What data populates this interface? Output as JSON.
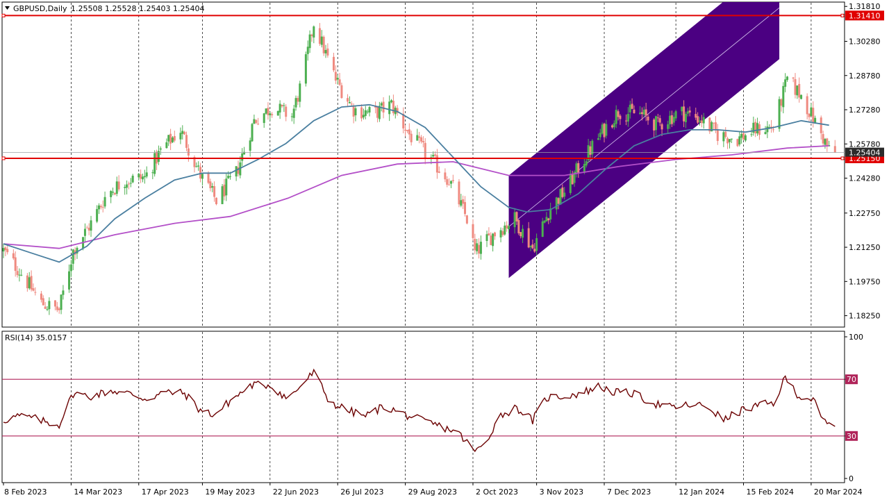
{
  "header": {
    "symbol": "GBPUSD,Daily",
    "ohlc": "1.25508 1.25528 1.25403 1.25404"
  },
  "rsi_header": {
    "label": "RSI(14) 35.0157"
  },
  "colors": {
    "background": "#ffffff",
    "up_candle": "#4caf50",
    "down_candle": "#ef8a80",
    "sma50": "#4a7fa0",
    "sma200": "#b34fc8",
    "channel_fill": "#4b0082",
    "hline": "#e00000",
    "rsi_line": "#6b0000",
    "rsi_level": "#b0245a",
    "grid": "#000000",
    "price_tag_bg": "#2b2b2b"
  },
  "icons": {
    "symbol_menu": "triangle-down-icon"
  },
  "chart_data": [
    {
      "type": "candlestick",
      "title": "GBPUSD,Daily",
      "ylim": [
        1.1775,
        1.32
      ],
      "y_ticks": [
        "1.31810",
        "1.30280",
        "1.28780",
        "1.27280",
        "1.25780",
        "1.24280",
        "1.22750",
        "1.21250",
        "1.19750",
        "1.18250"
      ],
      "x_ticks": [
        "8 Feb 2023",
        "14 Mar 2023",
        "17 Apr 2023",
        "19 May 2023",
        "22 Jun 2023",
        "26 Jul 2023",
        "29 Aug 2023",
        "2 Oct 2023",
        "3 Nov 2023",
        "7 Dec 2023",
        "12 Jan 2024",
        "15 Feb 2024",
        "20 Mar 2024"
      ],
      "x_range_days": [
        0,
        420
      ],
      "current_price": "1.25404",
      "horizontal_levels": [
        {
          "value": 1.3141,
          "label": "1.31410"
        },
        {
          "value": 1.2515,
          "label": "1.25150"
        }
      ],
      "channel": {
        "upper": [
          {
            "date": "20 Oct 2023",
            "value": 1.244
          },
          {
            "date": "4 Mar 2024",
            "value": 1.34
          }
        ],
        "lower": [
          {
            "date": "20 Oct 2023",
            "value": 1.199
          },
          {
            "date": "4 Mar 2024",
            "value": 1.295
          }
        ],
        "center": [
          {
            "date": "20 Oct 2023",
            "value": 1.2215
          },
          {
            "date": "4 Mar 2024",
            "value": 1.3175
          }
        ]
      },
      "price_path": [
        [
          "2023-02-08",
          1.211
        ],
        [
          "2023-02-17",
          1.201
        ],
        [
          "2023-02-27",
          1.188
        ],
        [
          "2023-03-08",
          1.185
        ],
        [
          "2023-03-15",
          1.211
        ],
        [
          "2023-03-24",
          1.223
        ],
        [
          "2023-04-01",
          1.236
        ],
        [
          "2023-04-10",
          1.242
        ],
        [
          "2023-04-20",
          1.243
        ],
        [
          "2023-04-29",
          1.256
        ],
        [
          "2023-05-08",
          1.264
        ],
        [
          "2023-05-18",
          1.244
        ],
        [
          "2023-05-26",
          1.233
        ],
        [
          "2023-06-05",
          1.245
        ],
        [
          "2023-06-14",
          1.268
        ],
        [
          "2023-06-23",
          1.274
        ],
        [
          "2023-07-03",
          1.27
        ],
        [
          "2023-07-08",
          1.285
        ],
        [
          "2023-07-14",
          1.311
        ],
        [
          "2023-07-25",
          1.286
        ],
        [
          "2023-08-03",
          1.273
        ],
        [
          "2023-08-13",
          1.271
        ],
        [
          "2023-08-22",
          1.275
        ],
        [
          "2023-08-31",
          1.262
        ],
        [
          "2023-09-10",
          1.252
        ],
        [
          "2023-09-20",
          1.242
        ],
        [
          "2023-09-30",
          1.223
        ],
        [
          "2023-10-03",
          1.21
        ],
        [
          "2023-10-13",
          1.219
        ],
        [
          "2023-10-23",
          1.225
        ],
        [
          "2023-11-01",
          1.212
        ],
        [
          "2023-11-10",
          1.23
        ],
        [
          "2023-11-17",
          1.237
        ],
        [
          "2023-11-26",
          1.25
        ],
        [
          "2023-12-05",
          1.262
        ],
        [
          "2023-12-14",
          1.272
        ],
        [
          "2023-12-25",
          1.271
        ],
        [
          "2024-01-03",
          1.266
        ],
        [
          "2024-01-14",
          1.272
        ],
        [
          "2024-01-24",
          1.269
        ],
        [
          "2024-02-02",
          1.262
        ],
        [
          "2024-02-12",
          1.26
        ],
        [
          "2024-02-21",
          1.264
        ],
        [
          "2024-03-01",
          1.265
        ],
        [
          "2024-03-08",
          1.286
        ],
        [
          "2024-03-15",
          1.279
        ],
        [
          "2024-03-24",
          1.264
        ],
        [
          "2024-03-29",
          1.255
        ],
        [
          "2024-04-01",
          1.254
        ]
      ],
      "sma50": [
        [
          "2023-02-08",
          1.214
        ],
        [
          "2023-02-22",
          1.21
        ],
        [
          "2023-03-08",
          1.206
        ],
        [
          "2023-03-22",
          1.213
        ],
        [
          "2023-04-05",
          1.225
        ],
        [
          "2023-04-20",
          1.234
        ],
        [
          "2023-05-05",
          1.242
        ],
        [
          "2023-05-19",
          1.245
        ],
        [
          "2023-06-02",
          1.245
        ],
        [
          "2023-06-16",
          1.251
        ],
        [
          "2023-06-30",
          1.258
        ],
        [
          "2023-07-14",
          1.268
        ],
        [
          "2023-07-28",
          1.274
        ],
        [
          "2023-08-11",
          1.275
        ],
        [
          "2023-08-25",
          1.272
        ],
        [
          "2023-09-08",
          1.265
        ],
        [
          "2023-09-22",
          1.252
        ],
        [
          "2023-10-06",
          1.239
        ],
        [
          "2023-10-20",
          1.23
        ],
        [
          "2023-10-29",
          1.228
        ],
        [
          "2023-11-10",
          1.229
        ],
        [
          "2023-11-24",
          1.236
        ],
        [
          "2023-12-08",
          1.247
        ],
        [
          "2023-12-22",
          1.257
        ],
        [
          "2024-01-05",
          1.262
        ],
        [
          "2024-01-19",
          1.264
        ],
        [
          "2024-02-02",
          1.264
        ],
        [
          "2024-02-16",
          1.263
        ],
        [
          "2024-03-01",
          1.265
        ],
        [
          "2024-03-15",
          1.268
        ],
        [
          "2024-03-29",
          1.266
        ]
      ],
      "sma200": [
        [
          "2023-02-08",
          1.214
        ],
        [
          "2023-03-08",
          1.212
        ],
        [
          "2023-04-05",
          1.218
        ],
        [
          "2023-05-05",
          1.223
        ],
        [
          "2023-06-02",
          1.226
        ],
        [
          "2023-07-01",
          1.234
        ],
        [
          "2023-07-28",
          1.244
        ],
        [
          "2023-08-25",
          1.249
        ],
        [
          "2023-09-22",
          1.25
        ],
        [
          "2023-10-20",
          1.244
        ],
        [
          "2023-11-17",
          1.244
        ],
        [
          "2023-12-15",
          1.248
        ],
        [
          "2024-01-12",
          1.251
        ],
        [
          "2024-02-09",
          1.253
        ],
        [
          "2024-03-08",
          1.256
        ],
        [
          "2024-03-29",
          1.257
        ]
      ]
    },
    {
      "type": "line",
      "title": "RSI(14) 35.0157",
      "ylim": [
        0,
        100
      ],
      "y_ticks": [
        "100",
        "70",
        "30",
        "0"
      ],
      "levels": [
        {
          "value": 70,
          "label": "70"
        },
        {
          "value": 30,
          "label": "30"
        }
      ],
      "series": [
        {
          "name": "RSI(14)",
          "values": [
            [
              "2023-02-08",
              41
            ],
            [
              "2023-02-15",
              44
            ],
            [
              "2023-02-22",
              43
            ],
            [
              "2023-03-01",
              40
            ],
            [
              "2023-03-08",
              38
            ],
            [
              "2023-03-15",
              60
            ],
            [
              "2023-03-24",
              58
            ],
            [
              "2023-04-03",
              62
            ],
            [
              "2023-04-12",
              60
            ],
            [
              "2023-04-21",
              56
            ],
            [
              "2023-04-30",
              61
            ],
            [
              "2023-05-10",
              60
            ],
            [
              "2023-05-18",
              48
            ],
            [
              "2023-05-25",
              45
            ],
            [
              "2023-06-03",
              56
            ],
            [
              "2023-06-13",
              66
            ],
            [
              "2023-06-22",
              66
            ],
            [
              "2023-07-01",
              56
            ],
            [
              "2023-07-14",
              75
            ],
            [
              "2023-07-22",
              54
            ],
            [
              "2023-07-31",
              48
            ],
            [
              "2023-08-09",
              44
            ],
            [
              "2023-08-18",
              51
            ],
            [
              "2023-08-27",
              46
            ],
            [
              "2023-09-06",
              41
            ],
            [
              "2023-09-15",
              37
            ],
            [
              "2023-09-24",
              33
            ],
            [
              "2023-10-03",
              19
            ],
            [
              "2023-10-08",
              24
            ],
            [
              "2023-10-15",
              44
            ],
            [
              "2023-10-24",
              50
            ],
            [
              "2023-11-01",
              41
            ],
            [
              "2023-11-08",
              57
            ],
            [
              "2023-11-16",
              58
            ],
            [
              "2023-11-25",
              60
            ],
            [
              "2023-12-04",
              65
            ],
            [
              "2023-12-12",
              61
            ],
            [
              "2023-12-21",
              60
            ],
            [
              "2024-01-01",
              53
            ],
            [
              "2024-01-10",
              50
            ],
            [
              "2024-01-19",
              52
            ],
            [
              "2024-01-28",
              51
            ],
            [
              "2024-02-05",
              41
            ],
            [
              "2024-02-14",
              48
            ],
            [
              "2024-02-24",
              52
            ],
            [
              "2024-03-01",
              53
            ],
            [
              "2024-03-07",
              71
            ],
            [
              "2024-03-14",
              58
            ],
            [
              "2024-03-21",
              56
            ],
            [
              "2024-03-25",
              42
            ],
            [
              "2024-04-01",
              35
            ]
          ]
        }
      ]
    }
  ]
}
